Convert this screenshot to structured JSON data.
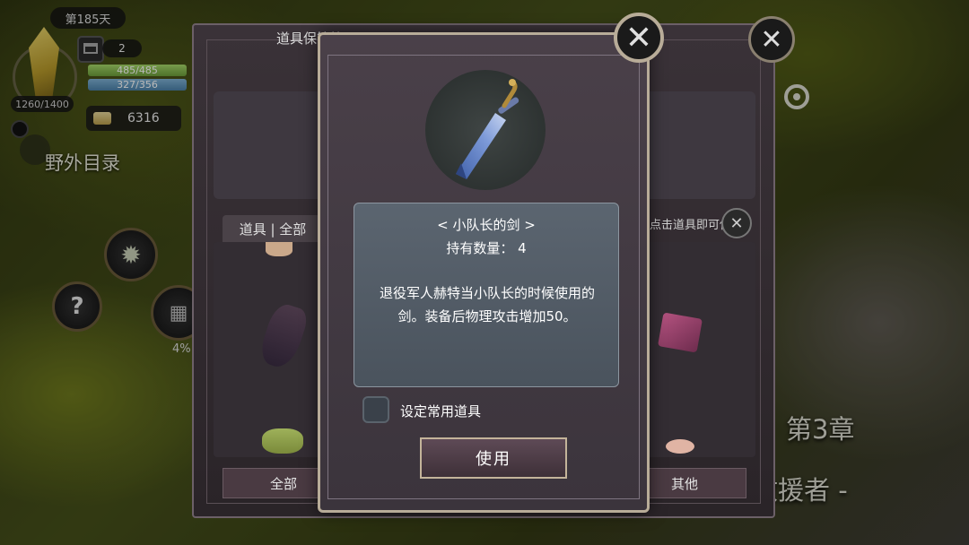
{
  "hud": {
    "day": "第185天",
    "calendar_count": "2",
    "hp": "485/485",
    "mp": "327/356",
    "energy": "1260/1400",
    "gold": "6316",
    "area_title": "野外目录",
    "progress_pct": "4%",
    "help_symbol": "?",
    "gear_symbol": "✹",
    "calendar_symbol": "▦"
  },
  "story": {
    "chapter": "第3章",
    "subtitle": "救援者 -"
  },
  "inventory": {
    "title": "道具保管箱",
    "tab_label": "道具 | 全部",
    "hint": "点击道具即可使用",
    "category_all": "全部",
    "category_other": "其他",
    "close_symbol": "✕"
  },
  "dialog": {
    "item_name": "< 小队长的剑 >",
    "quantity": "持有数量： 4",
    "description": "退役军人赫特当小队长的时候使用的剑。装备后物理攻击增加50。",
    "checkbox_label": "设定常用道具",
    "use_button": "使用",
    "close_symbol": "✕"
  },
  "colors": {
    "accent_border": "#b8ac98",
    "hp_bar": "#a6d86a",
    "mp_bar": "#7fb2d6"
  }
}
